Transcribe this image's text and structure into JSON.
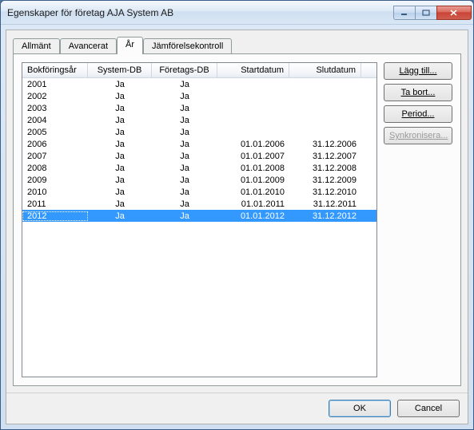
{
  "window": {
    "title": "Egenskaper för företag AJA System AB"
  },
  "tabs": [
    {
      "label": "Allmänt"
    },
    {
      "label": "Avancerat"
    },
    {
      "label": "År"
    },
    {
      "label": "Jämförelsekontroll"
    }
  ],
  "active_tab": 2,
  "columns": [
    "Bokföringsår",
    "System-DB",
    "Företags-DB",
    "Startdatum",
    "Slutdatum"
  ],
  "rows": [
    {
      "year": "2001",
      "sysdb": "Ja",
      "compdb": "Ja",
      "start": "",
      "end": ""
    },
    {
      "year": "2002",
      "sysdb": "Ja",
      "compdb": "Ja",
      "start": "",
      "end": ""
    },
    {
      "year": "2003",
      "sysdb": "Ja",
      "compdb": "Ja",
      "start": "",
      "end": ""
    },
    {
      "year": "2004",
      "sysdb": "Ja",
      "compdb": "Ja",
      "start": "",
      "end": ""
    },
    {
      "year": "2005",
      "sysdb": "Ja",
      "compdb": "Ja",
      "start": "",
      "end": ""
    },
    {
      "year": "2006",
      "sysdb": "Ja",
      "compdb": "Ja",
      "start": "01.01.2006",
      "end": "31.12.2006"
    },
    {
      "year": "2007",
      "sysdb": "Ja",
      "compdb": "Ja",
      "start": "01.01.2007",
      "end": "31.12.2007"
    },
    {
      "year": "2008",
      "sysdb": "Ja",
      "compdb": "Ja",
      "start": "01.01.2008",
      "end": "31.12.2008"
    },
    {
      "year": "2009",
      "sysdb": "Ja",
      "compdb": "Ja",
      "start": "01.01.2009",
      "end": "31.12.2009"
    },
    {
      "year": "2010",
      "sysdb": "Ja",
      "compdb": "Ja",
      "start": "01.01.2010",
      "end": "31.12.2010"
    },
    {
      "year": "2011",
      "sysdb": "Ja",
      "compdb": "Ja",
      "start": "01.01.2011",
      "end": "31.12.2011"
    },
    {
      "year": "2012",
      "sysdb": "Ja",
      "compdb": "Ja",
      "start": "01.01.2012",
      "end": "31.12.2012",
      "selected": true
    }
  ],
  "side_buttons": {
    "add": "Lägg till...",
    "remove": "Ta bort...",
    "period": "Period...",
    "sync": "Synkronisera..."
  },
  "bottom": {
    "ok": "OK",
    "cancel": "Cancel"
  }
}
